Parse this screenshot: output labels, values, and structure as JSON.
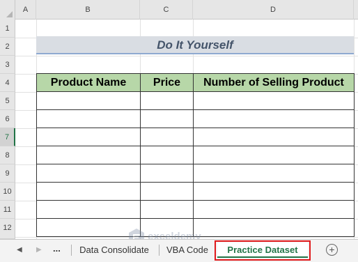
{
  "columns": [
    "A",
    "B",
    "C",
    "D"
  ],
  "rows": [
    "1",
    "2",
    "3",
    "4",
    "5",
    "6",
    "7",
    "8",
    "9",
    "10",
    "11",
    "12"
  ],
  "active_row": "7",
  "title": "Do It Yourself",
  "table": {
    "headers": [
      "Product Name",
      "Price",
      "Number of Selling Product"
    ],
    "empty_rows": 8,
    "header_fill": "#b7d7a8"
  },
  "tabs": {
    "ellipsis": "...",
    "items": [
      "Data Consolidate",
      "VBA Code",
      "Practice Dataset"
    ],
    "active": "Practice Dataset",
    "add_symbol": "+"
  },
  "watermark": {
    "name": "exceldemy",
    "tagline": "EXCEL · DATA · BI"
  },
  "colors": {
    "accent": "#217346",
    "highlight": "#e0191b",
    "title_bar": "#d9dde3"
  },
  "icons": [
    "scroll-left-icon",
    "scroll-right-icon",
    "add-sheet-icon",
    "select-all-icon"
  ]
}
